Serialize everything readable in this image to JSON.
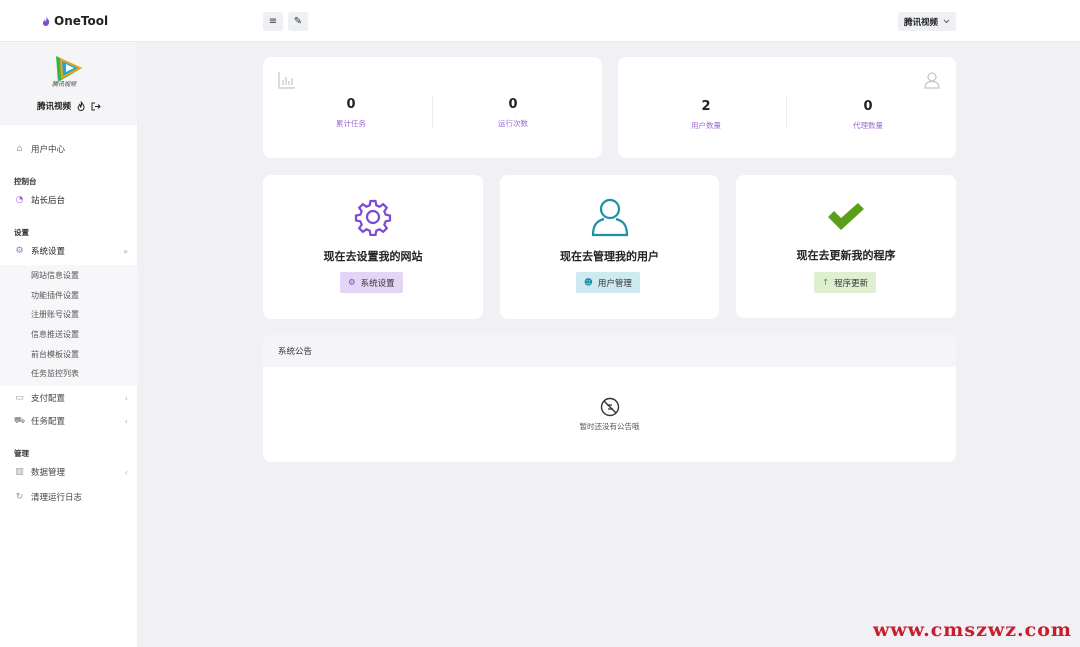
{
  "app": {
    "name": "OneTool"
  },
  "topbar": {
    "menu_icon": "≡",
    "brush_icon": "✎",
    "user_label": "腾讯视频",
    "dropdown_icon": "chevron-down-icon"
  },
  "profile": {
    "name": "腾讯视频",
    "logo_caption": "腾讯视频"
  },
  "sidebar": {
    "user_center": "用户中心",
    "section_console": "控制台",
    "admin_backend": "站长后台",
    "section_settings": "设置",
    "system_settings": "系统设置",
    "sub_items": [
      "网站信息设置",
      "功能插件设置",
      "注册账号设置",
      "信息推送设置",
      "前台模板设置",
      "任务监控列表"
    ],
    "payment_config": "支付配置",
    "task_config": "任务配置",
    "section_manage": "管理",
    "data_manage": "数据管理",
    "clear_logs": "清理运行日志"
  },
  "stats_left": [
    {
      "value": "0",
      "label": "累计任务"
    },
    {
      "value": "0",
      "label": "运行次数"
    }
  ],
  "stats_right": [
    {
      "value": "2",
      "label": "用户数量"
    },
    {
      "value": "0",
      "label": "代理数量"
    }
  ],
  "actions": [
    {
      "title": "现在去设置我的网站",
      "button": "系统设置",
      "icon": "gear-icon",
      "color": "#7b4bd6"
    },
    {
      "title": "现在去管理我的用户",
      "button": "用户管理",
      "icon": "user-icon",
      "color": "#1e8fa8"
    },
    {
      "title": "现在去更新我的程序",
      "button": "程序更新",
      "icon": "check-icon",
      "color": "#5a9e1a"
    }
  ],
  "notice": {
    "title": "系统公告",
    "empty_text": "暂时还没有公告哦"
  },
  "watermark": "www.cmszwz.com"
}
